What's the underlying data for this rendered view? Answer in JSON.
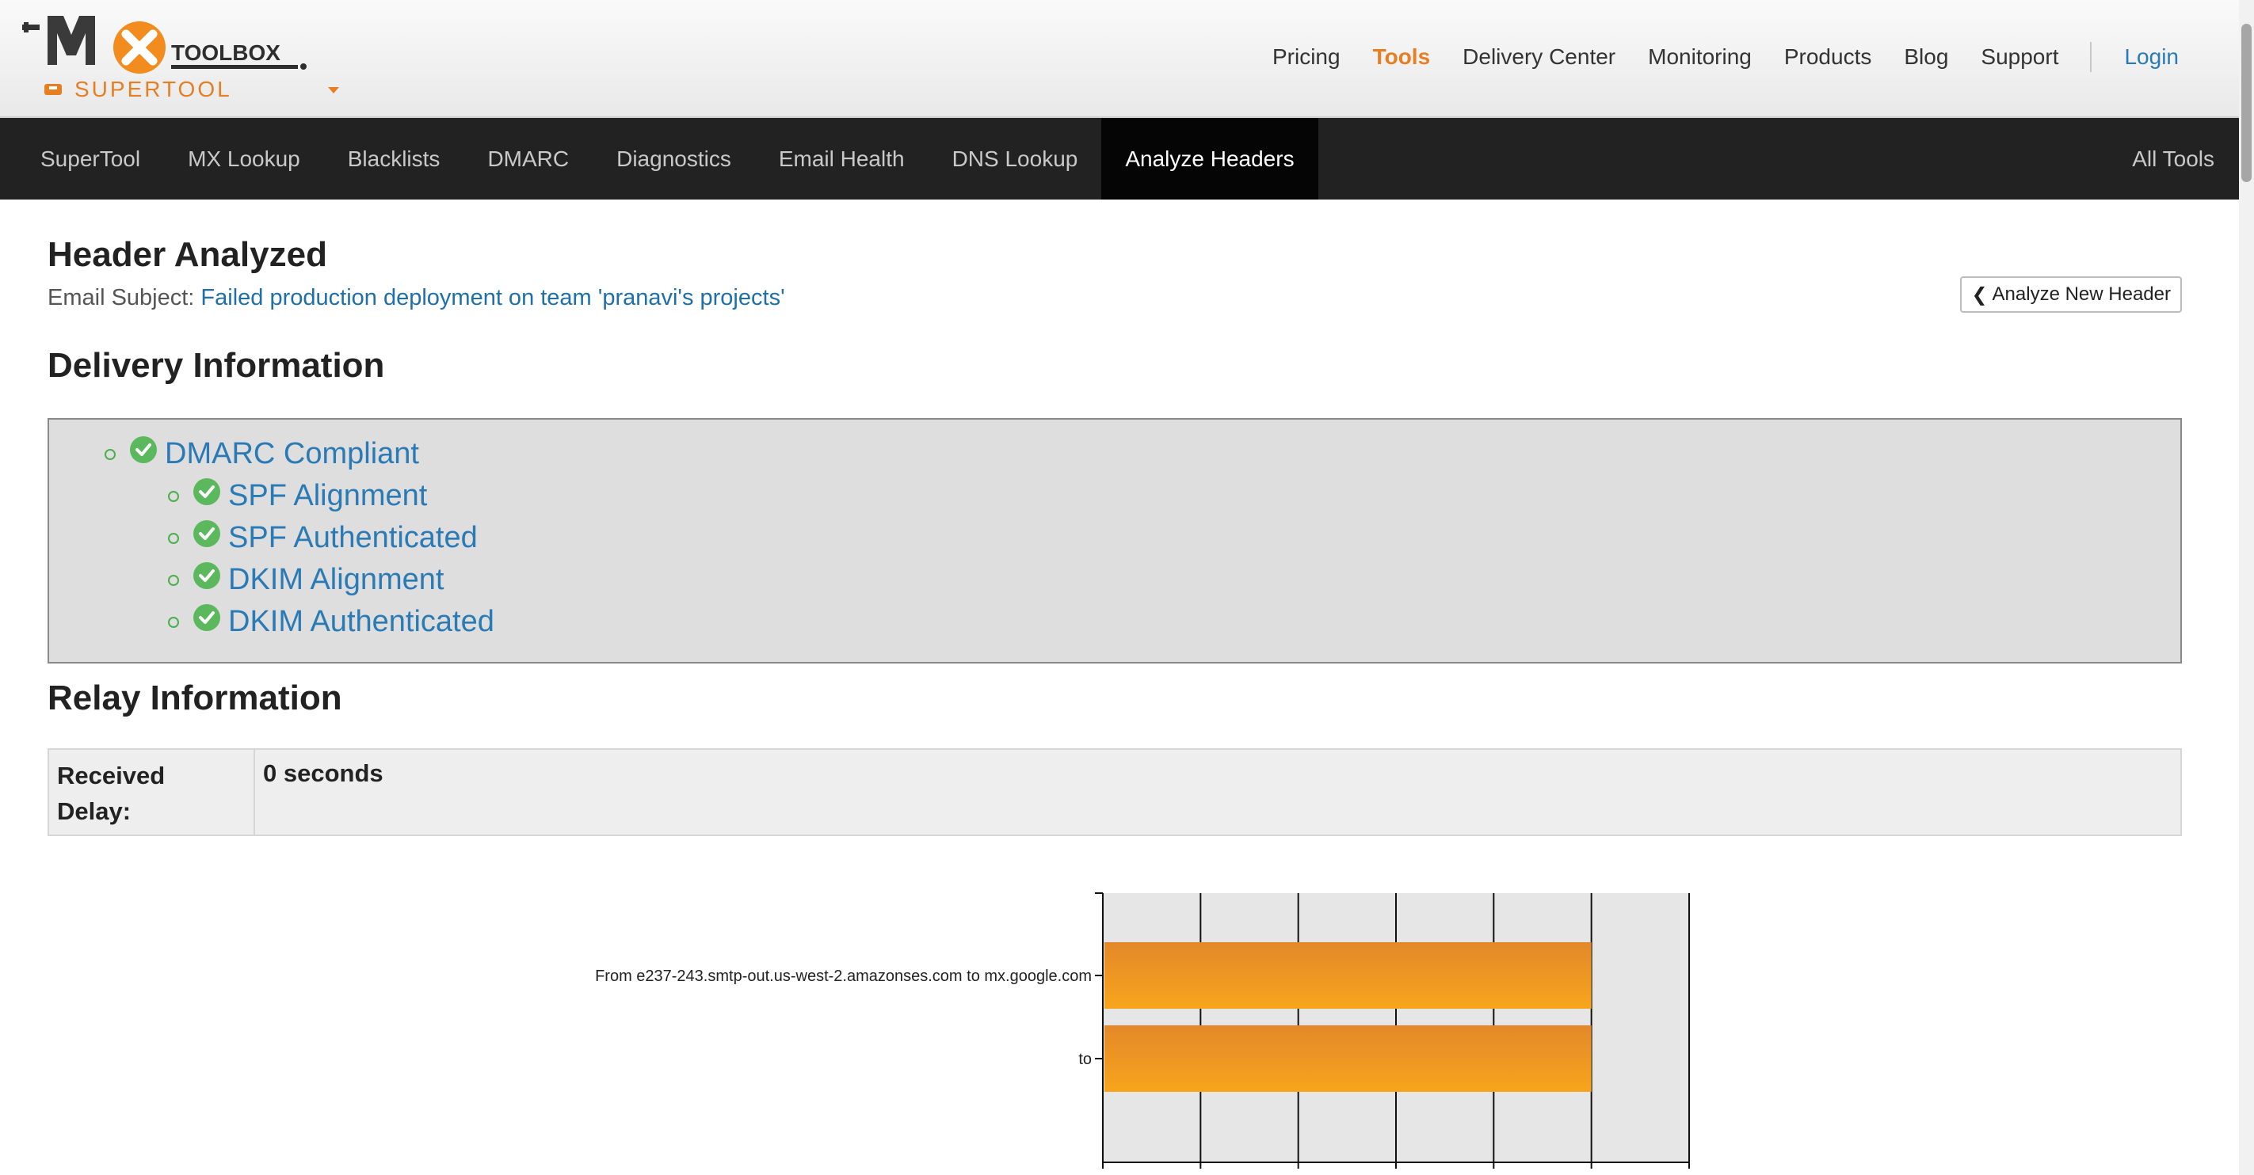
{
  "logo": {
    "brand": "TOOLBOX",
    "mark": "MX",
    "product": "SUPERTOOL"
  },
  "top_nav": {
    "items": [
      {
        "label": "Pricing"
      },
      {
        "label": "Tools"
      },
      {
        "label": "Delivery Center"
      },
      {
        "label": "Monitoring"
      },
      {
        "label": "Products"
      },
      {
        "label": "Blog"
      },
      {
        "label": "Support"
      }
    ],
    "login": "Login"
  },
  "tool_tabs": {
    "items": [
      {
        "label": "SuperTool"
      },
      {
        "label": "MX Lookup"
      },
      {
        "label": "Blacklists"
      },
      {
        "label": "DMARC"
      },
      {
        "label": "Diagnostics"
      },
      {
        "label": "Email Health"
      },
      {
        "label": "DNS Lookup"
      },
      {
        "label": "Analyze Headers"
      }
    ],
    "all_tools": "All Tools"
  },
  "header": {
    "title": "Header Analyzed",
    "subject_label": "Email Subject:",
    "subject_value": "Failed production deployment on team 'pranavi's projects'",
    "analyze_new": "Analyze New Header"
  },
  "delivery": {
    "title": "Delivery Information",
    "items": [
      {
        "label": "DMARC Compliant"
      },
      {
        "label": "SPF Alignment"
      },
      {
        "label": "SPF Authenticated"
      },
      {
        "label": "DKIM Alignment"
      },
      {
        "label": "DKIM Authenticated"
      }
    ]
  },
  "relay": {
    "title": "Relay Information",
    "received_delay_label": "Received Delay:",
    "received_delay_value": "0 seconds"
  },
  "colors": {
    "accent": "#e67e22",
    "link": "#2a7ab5",
    "bar_top": "#e3882a",
    "bar_bottom": "#f7a51c",
    "check": "#5cb85c"
  },
  "chart_data": {
    "type": "bar",
    "orientation": "horizontal",
    "categories": [
      "From  e237-243.smtp-out.us-west-2.amazonses.com  to  mx.google.com",
      "to"
    ],
    "values": [
      1,
      1
    ],
    "xlim": [
      0,
      1.2
    ],
    "xticks": [
      "0",
      "0.2",
      "0.4",
      "0.6",
      "0.8",
      "1",
      "1.2"
    ],
    "grid": true
  }
}
